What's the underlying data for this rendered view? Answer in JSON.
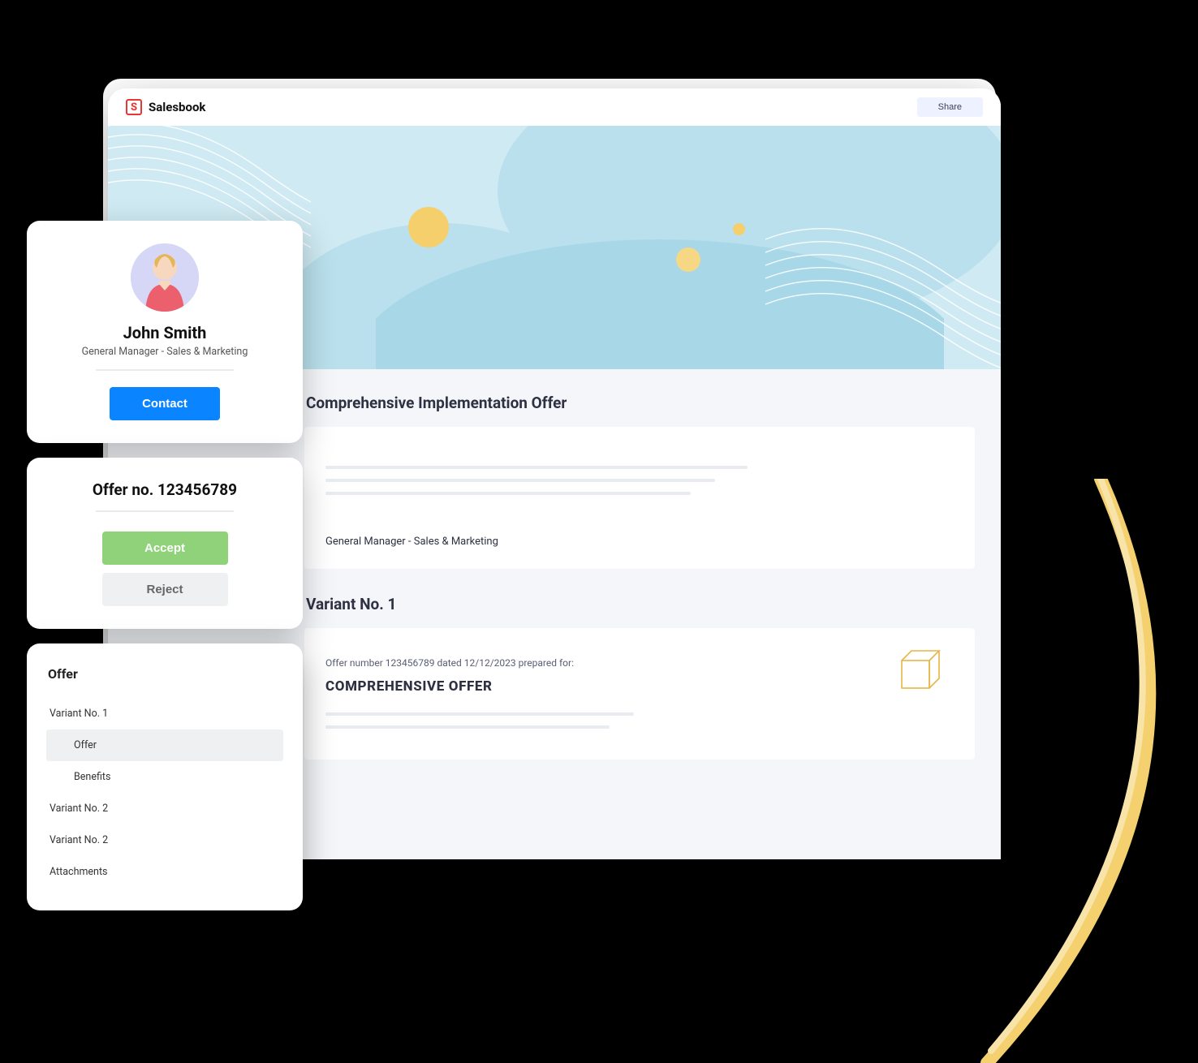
{
  "topbar": {
    "brand_name": "Salesbook",
    "brand_mark": "S",
    "share_label": "Share"
  },
  "hero": {},
  "section1": {
    "title": "Comprehensive Implementation Offer",
    "meta": "General Manager - Sales & Marketing"
  },
  "section2": {
    "title": "Variant No. 1",
    "offer_meta": "Offer number 123456789 dated 12/12/2023 prepared for:",
    "offer_title": "COMPREHENSIVE OFFER"
  },
  "profile": {
    "name": "John Smith",
    "role": "General Manager - Sales & Marketing",
    "contact_label": "Contact"
  },
  "offer_panel": {
    "heading": "Offer no. 123456789",
    "accept_label": "Accept",
    "reject_label": "Reject"
  },
  "nav": {
    "title": "Offer",
    "items": [
      {
        "label": "Variant No. 1"
      },
      {
        "label": "Offer",
        "sub": true,
        "active": true
      },
      {
        "label": "Benefits",
        "sub": true
      },
      {
        "label": "Variant No. 2"
      },
      {
        "label": "Variant No. 2"
      },
      {
        "label": "Attachments"
      }
    ]
  }
}
